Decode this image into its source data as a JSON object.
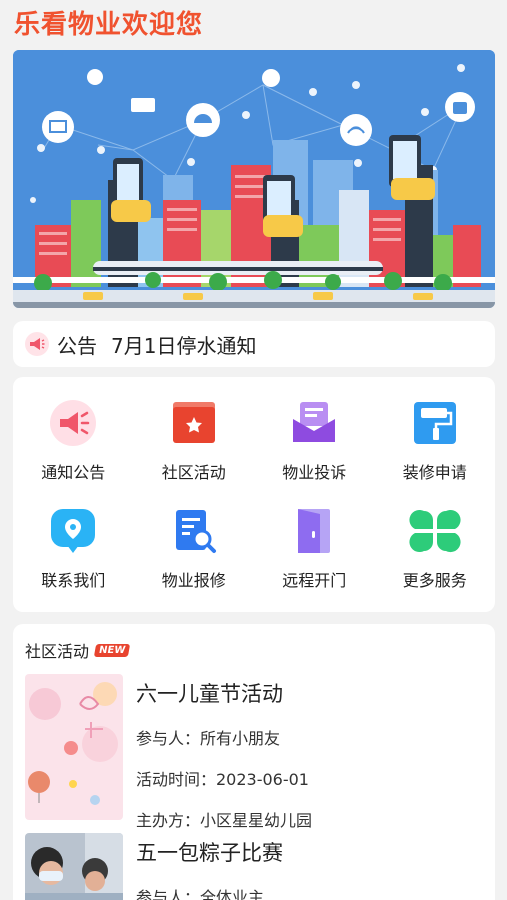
{
  "app": {
    "title": "乐看物业欢迎您"
  },
  "notice": {
    "label": "公告",
    "text": "7月1日停水通知"
  },
  "services": [
    {
      "label": "通知公告",
      "icon": "megaphone-icon",
      "color": "#f0566a"
    },
    {
      "label": "社区活动",
      "icon": "star-box-icon",
      "color": "#e8442f"
    },
    {
      "label": "物业投诉",
      "icon": "envelope-icon",
      "color": "#8e4be0"
    },
    {
      "label": "装修申请",
      "icon": "paint-roller-icon",
      "color": "#2f9bf0"
    },
    {
      "label": "联系我们",
      "icon": "chat-bubble-icon",
      "color": "#2ab3f5"
    },
    {
      "label": "物业报修",
      "icon": "document-search-icon",
      "color": "#2f7af0"
    },
    {
      "label": "远程开门",
      "icon": "door-icon",
      "color": "#8e6cf0"
    },
    {
      "label": "更多服务",
      "icon": "clover-icon",
      "color": "#2dcc7a"
    }
  ],
  "activities": {
    "title": "社区活动",
    "badge": "NEW",
    "items": [
      {
        "name": "六一儿童节活动",
        "participants": "参与人：所有小朋友",
        "time": "活动时间：2023-06-01",
        "organizer": "主办方：小区星星幼儿园"
      },
      {
        "name": "五一包粽子比赛",
        "participants": "参与人：全体业主"
      }
    ]
  }
}
